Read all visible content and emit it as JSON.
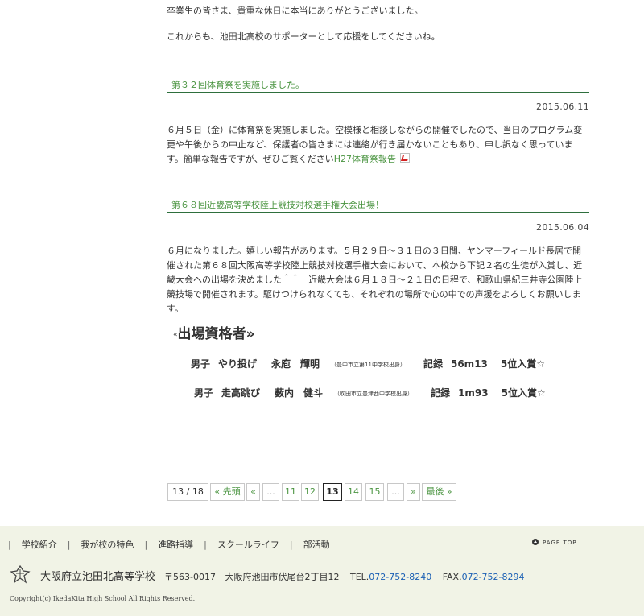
{
  "intro": {
    "line1": "卒業生の皆さま、貴重な休日に本当にありがとうございました。",
    "line2": "これからも、池田北高校のサポーターとして応援をしてくださいね。"
  },
  "posts": [
    {
      "title": "第３２回体育祭を実施しました。",
      "date": "2015.06.11",
      "body": "６月５日（金）に体育祭を実施しました。空模様と相談しながらの開催でしたので、当日のプログラム変更や午後からの中止など、保護者の皆さまには連絡が行き届かないこともあり、申し訳なく思っています。簡単な報告ですが、ぜひご覧ください",
      "link": "H27体育祭報告"
    },
    {
      "title": "第６８回近畿高等学校陸上競技対校選手権大会出場！",
      "date": "2015.06.04",
      "body": "６月になりました。嬉しい報告があります。５月２９日～３１日の３日間、ヤンマーフィールド長居で開催された第６８回大阪高等学校陸上競技対校選手権大会において、本校から下記２名の生徒が入賞し、近畿大会への出場を決めました＾＾　近畿大会は６月１８日～２１日の日程で、和歌山県紀三井寺公園陸上競技場で開催されます。駆けつけられなくても、それぞれの場所で心の中での声援をよろしくお願いします。"
    }
  ],
  "qualifiers": {
    "heading_left": "«",
    "heading": "出場資格者",
    "heading_right": "»",
    "rows": [
      {
        "gender": "男子",
        "event": "やり投げ",
        "name": "永庖　輝明",
        "school": "（豊中市立第11中学校出身）",
        "record_label": "記録",
        "record": "56m13",
        "rank": "5位入賞☆"
      },
      {
        "gender": "男子",
        "event": "走高跳び",
        "name": "藪内　健斗",
        "school": "（吹田市立豊津西中学校出身）",
        "record_label": "記録",
        "record": "1m93",
        "rank": "5位入賞☆"
      }
    ]
  },
  "pager": {
    "count": "13 / 18",
    "first": "« 先頭",
    "prev": "«",
    "dots": "...",
    "pages": [
      "11",
      "12",
      "13",
      "14",
      "15"
    ],
    "next": "»",
    "last": "最後 »"
  },
  "footer": {
    "nav": [
      "学校紹介",
      "我が校の特色",
      "進路指導",
      "スクールライフ",
      "部活動"
    ],
    "sep": "|",
    "pagetop": "PAGE TOP",
    "school_name": "大阪府立池田北高等学校",
    "postal": "〒563-0017",
    "address": "大阪府池田市伏尾台2丁目12",
    "tel_label": "TEL.",
    "tel": "072-752-8240",
    "fax_label": "FAX.",
    "fax": "072-752-8294",
    "copyright": "Copyright(c) IkedaKita High School All Rights Reserved."
  }
}
